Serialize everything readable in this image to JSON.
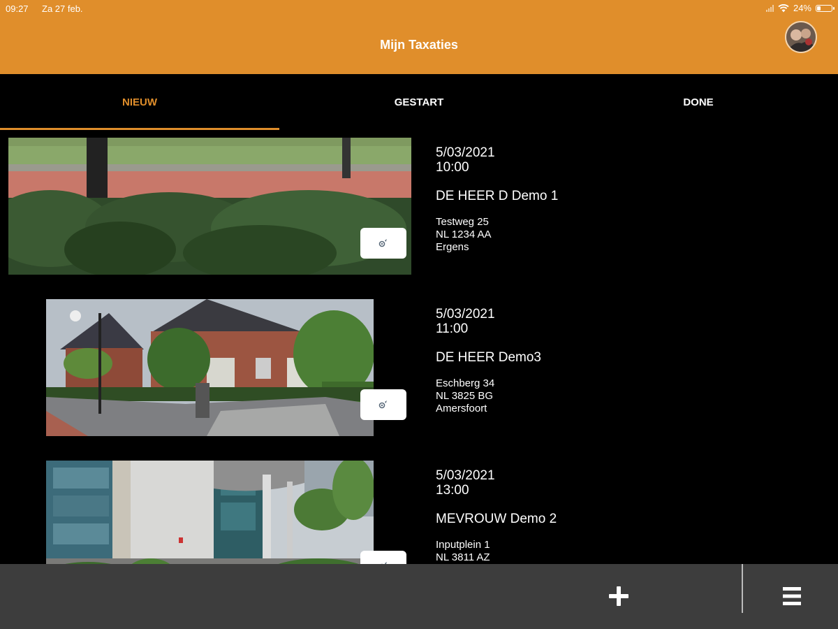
{
  "status_bar": {
    "time": "09:27",
    "date": "Za 27 feb.",
    "battery": "24%",
    "battery_level": 0.24
  },
  "header": {
    "title": "Mijn Taxaties"
  },
  "tabs": [
    {
      "label": "NIEUW",
      "active": true
    },
    {
      "label": "GESTART",
      "active": false
    },
    {
      "label": "DONE",
      "active": false
    }
  ],
  "appointments": [
    {
      "date": "5/03/2021",
      "time": "10:00",
      "name": "DE HEER D Demo 1",
      "street": "Testweg 25",
      "postal": "NL 1234 AA",
      "city": "Ergens"
    },
    {
      "date": "5/03/2021",
      "time": "11:00",
      "name": "DE HEER Demo3",
      "street": "Eschberg 34",
      "postal": "NL 3825 BG",
      "city": "Amersfoort"
    },
    {
      "date": "5/03/2021",
      "time": "13:00",
      "name": "MEVROUW Demo 2",
      "street": "Inputplein 1",
      "postal": "NL 3811 AZ",
      "city": ""
    }
  ],
  "icons": {
    "navigate": "navigation-icon",
    "add": "plus-icon",
    "menu": "hamburger-menu-icon",
    "wifi": "wifi-icon",
    "signal": "signal-icon",
    "battery": "battery-icon"
  },
  "colors": {
    "accent": "#E08E2B",
    "background": "#000000",
    "bottom_bar": "#3d3d3d"
  }
}
